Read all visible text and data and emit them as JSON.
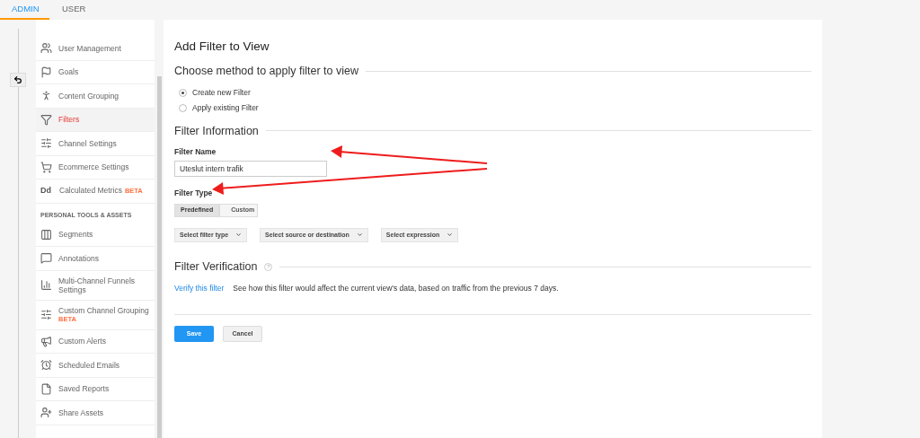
{
  "top_tabs": [
    {
      "label": "ADMIN",
      "selected": true
    },
    {
      "label": "USER",
      "selected": false
    }
  ],
  "sidebar": {
    "items": [
      {
        "kind": "item",
        "label": "User Management",
        "selected": false
      },
      {
        "kind": "item",
        "label": "Goals",
        "selected": false
      },
      {
        "kind": "item",
        "label": "Content Grouping",
        "selected": false
      },
      {
        "kind": "item",
        "label": "Filters",
        "selected": true
      },
      {
        "kind": "item",
        "label": "Channel Settings",
        "selected": false
      },
      {
        "kind": "item",
        "label": "Ecommerce Settings",
        "selected": false
      },
      {
        "kind": "item",
        "label": "Calculated Metrics",
        "badge": "BETA",
        "icon_text": "Dd",
        "selected": false
      },
      {
        "kind": "header",
        "label": "PERSONAL TOOLS & ASSETS"
      },
      {
        "kind": "item",
        "label": "Segments",
        "selected": false
      },
      {
        "kind": "item",
        "label": "Annotations",
        "selected": false
      },
      {
        "kind": "item",
        "label": "Multi-Channel Funnels Settings",
        "selected": false
      },
      {
        "kind": "item",
        "label": "Custom Channel Grouping",
        "badge": "BETA",
        "badge_below": true,
        "selected": false
      },
      {
        "kind": "item",
        "label": "Custom Alerts",
        "selected": false
      },
      {
        "kind": "item",
        "label": "Scheduled Emails",
        "selected": false
      },
      {
        "kind": "item",
        "label": "Saved Reports",
        "selected": false
      },
      {
        "kind": "item",
        "label": "Share Assets",
        "selected": false
      }
    ]
  },
  "main": {
    "title": "Add Filter to View",
    "method": {
      "heading": "Choose method to apply filter to view",
      "options": [
        {
          "label": "Create new Filter",
          "selected": true
        },
        {
          "label": "Apply existing Filter",
          "selected": false
        }
      ]
    },
    "info": {
      "heading": "Filter Information",
      "name_label": "Filter Name",
      "name_value": "Uteslut intern trafik",
      "type_label": "Filter Type",
      "type_tabs": [
        {
          "label": "Predefined",
          "selected": true
        },
        {
          "label": "Custom",
          "selected": false
        }
      ],
      "dropdowns": [
        "Select filter type",
        "Select source or destination",
        "Select expression"
      ]
    },
    "verification": {
      "heading": "Filter Verification",
      "help": "?",
      "link": "Verify this filter",
      "text": "See how this filter would affect the current view's data, based on traffic from the previous 7 days."
    },
    "buttons": [
      {
        "label": "Save",
        "kind": "primary"
      },
      {
        "label": "Cancel",
        "kind": "secondary"
      }
    ]
  }
}
